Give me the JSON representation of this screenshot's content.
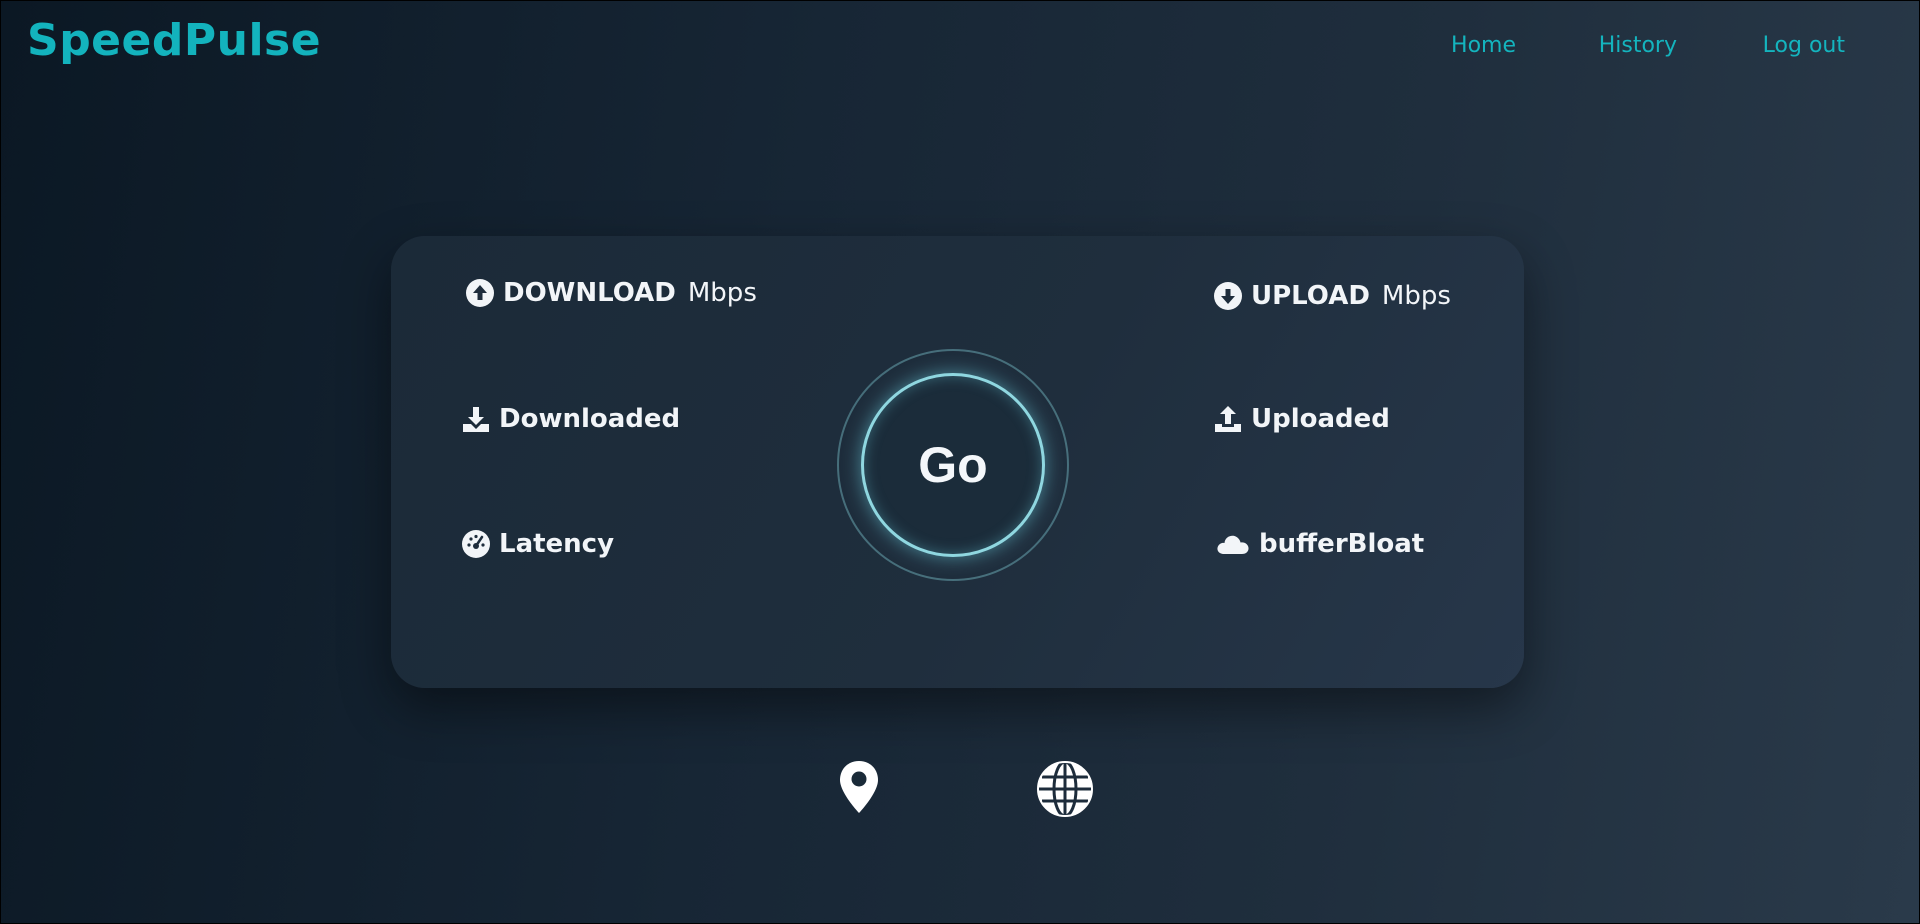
{
  "app": {
    "title": "SpeedPulse"
  },
  "nav": {
    "items": [
      {
        "label": "Home"
      },
      {
        "label": "History"
      },
      {
        "label": "Log out"
      }
    ]
  },
  "card": {
    "download": {
      "label": "DOWNLOAD",
      "unit": "Mbps",
      "icon": "arrow-circle-up-icon"
    },
    "upload": {
      "label": "UPLOAD",
      "unit": "Mbps",
      "icon": "arrow-circle-down-icon"
    },
    "downloaded": {
      "label": "Downloaded",
      "icon": "download-tray-icon"
    },
    "uploaded": {
      "label": "Uploaded",
      "icon": "upload-tray-icon"
    },
    "latency": {
      "label": "Latency",
      "icon": "gauge-icon"
    },
    "bufferbloat": {
      "label": "bufferBloat",
      "icon": "cloud-icon"
    },
    "go_label": "Go"
  },
  "footer_icons": [
    "map-pin-icon",
    "globe-icon"
  ],
  "colors": {
    "accent": "#13b3bd",
    "ring": "#8fd7e0",
    "card": "#1f2e3d"
  }
}
